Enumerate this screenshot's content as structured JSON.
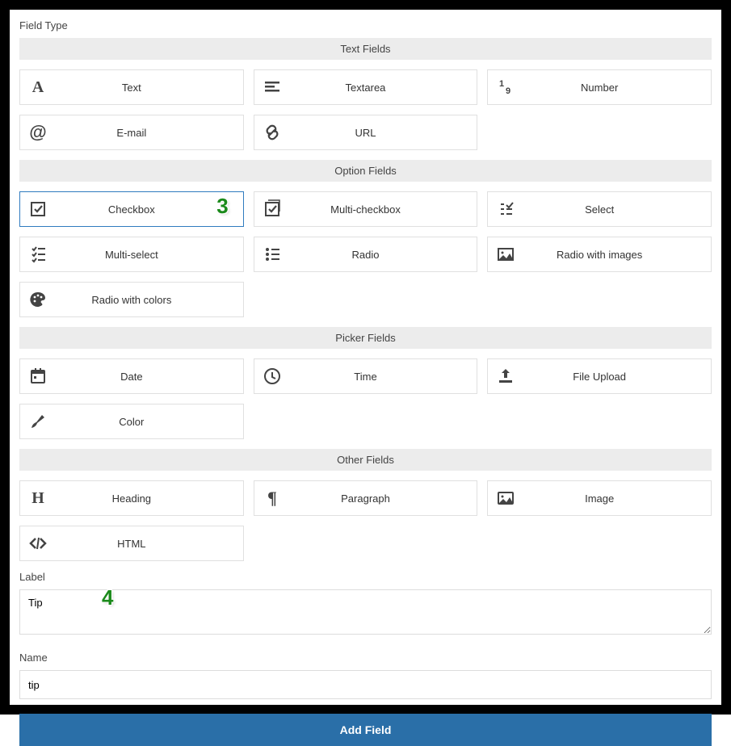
{
  "title": "Field Type",
  "groups": {
    "text": {
      "header": "Text Fields",
      "items": [
        {
          "label": "Text",
          "icon": "letter-a",
          "name": "field-text"
        },
        {
          "label": "Textarea",
          "icon": "align-left",
          "name": "field-textarea"
        },
        {
          "label": "Number",
          "icon": "one-nine",
          "name": "field-number"
        },
        {
          "label": "E-mail",
          "icon": "at",
          "name": "field-email"
        },
        {
          "label": "URL",
          "icon": "link",
          "name": "field-url"
        }
      ]
    },
    "option": {
      "header": "Option Fields",
      "items": [
        {
          "label": "Checkbox",
          "icon": "checkbox",
          "name": "field-checkbox",
          "selected": true
        },
        {
          "label": "Multi-checkbox",
          "icon": "multi-checkbox",
          "name": "field-multi-checkbox"
        },
        {
          "label": "Select",
          "icon": "select",
          "name": "field-select"
        },
        {
          "label": "Multi-select",
          "icon": "multi-select",
          "name": "field-multi-select"
        },
        {
          "label": "Radio",
          "icon": "radio-list",
          "name": "field-radio"
        },
        {
          "label": "Radio with images",
          "icon": "image-radio",
          "name": "field-radio-images"
        },
        {
          "label": "Radio with colors",
          "icon": "palette",
          "name": "field-radio-colors"
        }
      ]
    },
    "picker": {
      "header": "Picker Fields",
      "items": [
        {
          "label": "Date",
          "icon": "calendar",
          "name": "field-date"
        },
        {
          "label": "Time",
          "icon": "clock",
          "name": "field-time"
        },
        {
          "label": "File Upload",
          "icon": "upload",
          "name": "field-file-upload"
        },
        {
          "label": "Color",
          "icon": "brush",
          "name": "field-color"
        }
      ]
    },
    "other": {
      "header": "Other Fields",
      "items": [
        {
          "label": "Heading",
          "icon": "letter-h",
          "name": "field-heading"
        },
        {
          "label": "Paragraph",
          "icon": "pilcrow",
          "name": "field-paragraph"
        },
        {
          "label": "Image",
          "icon": "image",
          "name": "field-image"
        },
        {
          "label": "HTML",
          "icon": "code",
          "name": "field-html"
        }
      ]
    }
  },
  "form": {
    "label_field_label": "Label",
    "label_value": "Tip",
    "name_field_label": "Name",
    "name_value": "tip",
    "submit_label": "Add Field"
  },
  "callouts": {
    "c3": "3",
    "c4": "4"
  }
}
